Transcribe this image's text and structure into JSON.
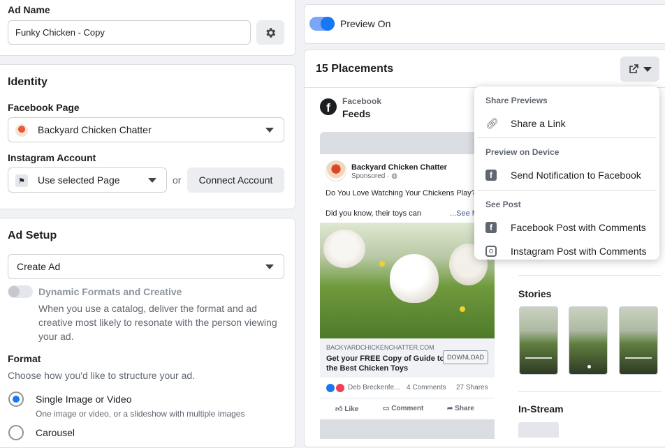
{
  "ad_name": {
    "label": "Ad Name",
    "value": "Funky Chicken - Copy"
  },
  "identity": {
    "title": "Identity",
    "facebook_page_label": "Facebook Page",
    "facebook_page_value": "Backyard Chicken Chatter",
    "instagram_label": "Instagram Account",
    "instagram_value": "Use selected Page",
    "or": "or",
    "connect_button": "Connect Account"
  },
  "ad_setup": {
    "title": "Ad Setup",
    "create_select": "Create Ad",
    "dynamic_label": "Dynamic Formats and Creative",
    "dynamic_desc": "When you use a catalog, deliver the format and ad creative most likely to resonate with the person viewing your ad.",
    "format_label": "Format",
    "format_desc": "Choose how you'd like to structure your ad.",
    "options": [
      {
        "label": "Single Image or Video",
        "desc": "One image or video, or a slideshow with multiple images",
        "selected": true
      },
      {
        "label": "Carousel",
        "desc": "",
        "selected": false
      }
    ]
  },
  "preview": {
    "toggle_label": "Preview On",
    "placements_title": "15 Placements",
    "platform": "Facebook",
    "placement": "Feeds",
    "stories_title": "Stories",
    "instream_title": "In-Stream"
  },
  "post": {
    "page_name": "Backyard Chicken Chatter",
    "sponsored": "Sponsored · ",
    "headline_text": "Do You Love Watching Your Chickens Play?",
    "body_text": "Did you know, their toys can",
    "see_more": "...See M",
    "domain": "BACKYARDCHICKENCHATTER.COM",
    "cta_title": "Get your FREE Copy of Guide to the Best Chicken Toys",
    "cta_button": "DOWNLOAD",
    "reactors": "Deb Breckenfe...",
    "comments": "4 Comments",
    "shares": "27 Shares",
    "like": "Like",
    "comment": "Comment",
    "share": "Share"
  },
  "share_menu": {
    "share_previews_header": "Share Previews",
    "share_link": "Share a Link",
    "device_header": "Preview on Device",
    "send_notification": "Send Notification to Facebook",
    "see_post_header": "See Post",
    "fb_post": "Facebook Post with Comments",
    "ig_post": "Instagram Post with Comments"
  },
  "colors": {
    "accent": "#1877f2",
    "toggle_bg": "#6d9df5"
  }
}
